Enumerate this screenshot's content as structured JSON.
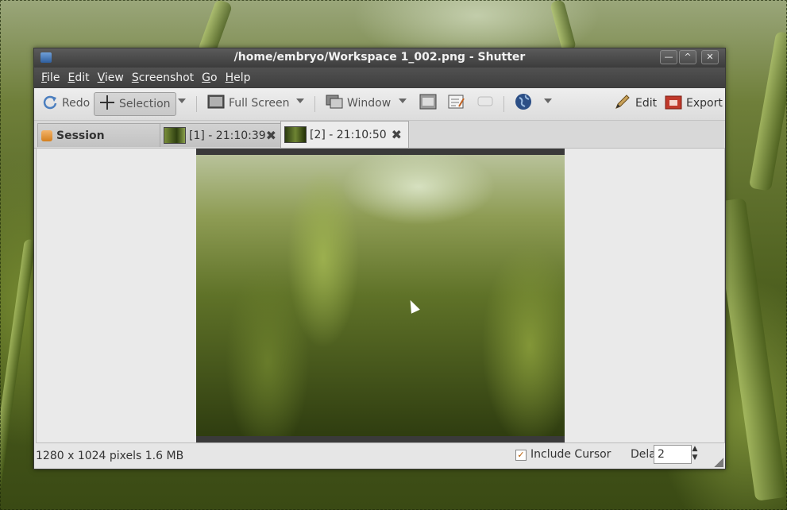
{
  "window": {
    "title": "/home/embryo/Workspace 1_002.png - Shutter"
  },
  "menu": [
    "File",
    "Edit",
    "View",
    "Screenshot",
    "Go",
    "Help"
  ],
  "toolbar": {
    "redo": "Redo",
    "selection": "Selection",
    "fullscreen": "Full Screen",
    "window": "Window",
    "edit": "Edit",
    "export": "Export"
  },
  "tabs": {
    "session": "Session",
    "tab1": "[1] - 21:10:39",
    "tab2": "[2] - 21:10:50"
  },
  "status": {
    "info": "1280 x 1024 pixels  1.6 MB",
    "include_cursor_label": "Include Cursor",
    "include_cursor_checked": true,
    "delay_label": "Delay:",
    "delay_value": "2"
  },
  "icons": {
    "app": "shutter-icon",
    "redo": "redo-icon",
    "selection": "crosshair-icon",
    "fullscreen": "fullscreen-icon",
    "window": "window-icon",
    "edit": "edit-icon",
    "export": "export-icon",
    "web": "globe-icon"
  }
}
